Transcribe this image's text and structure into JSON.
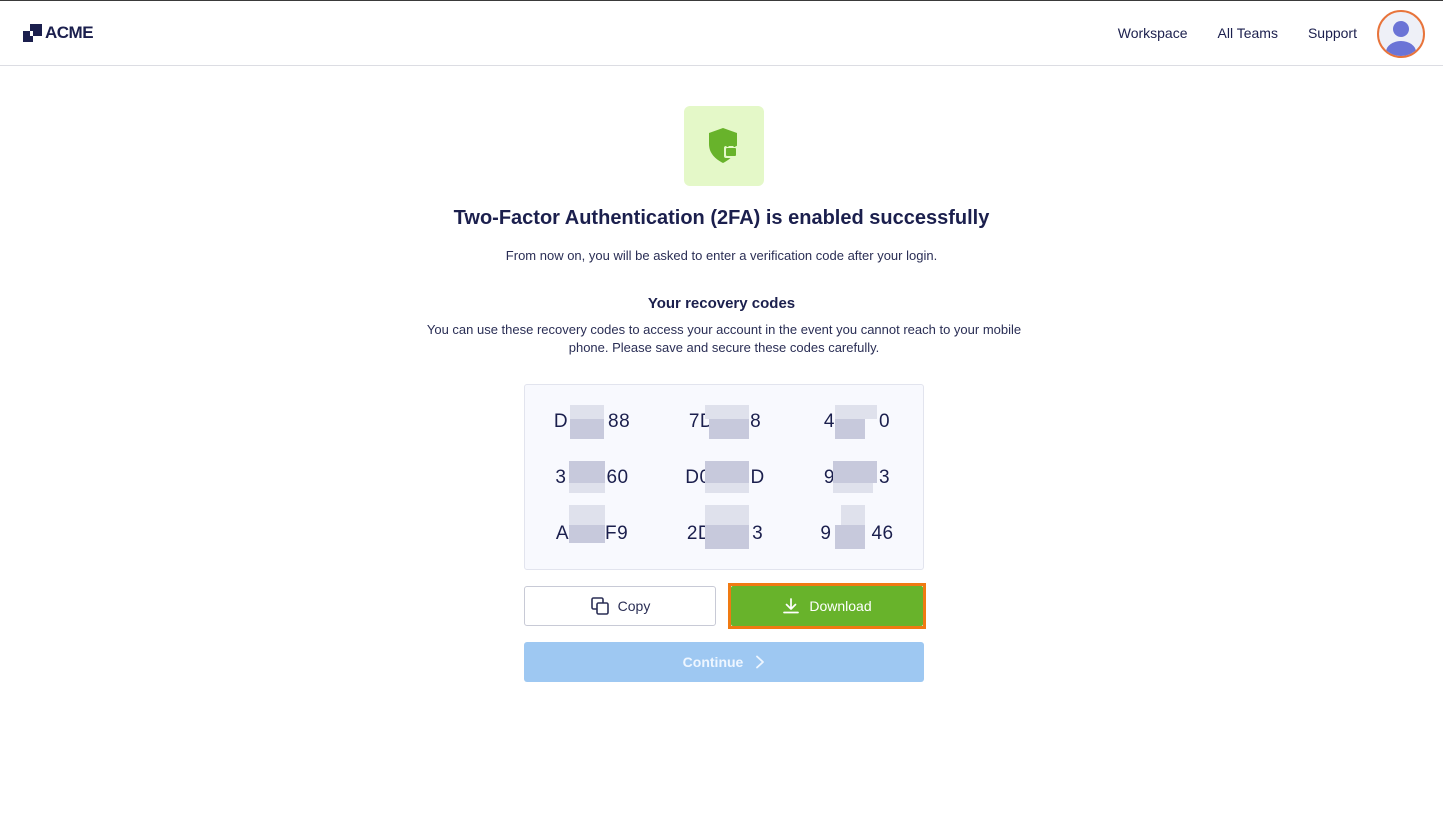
{
  "header": {
    "logo_text": "ACME",
    "nav": [
      {
        "label": "Workspace"
      },
      {
        "label": "All Teams"
      },
      {
        "label": "Support"
      }
    ]
  },
  "main": {
    "title": "Two-Factor Authentication (2FA) is enabled successfully",
    "subtitle": "From now on, you will be asked to enter a verification code after your login.",
    "codes_heading": "Your recovery codes",
    "codes_description": "You can use these recovery codes to access your account in the event you cannot reach to your mobile phone. Please save and secure these codes carefully.",
    "codes": [
      {
        "prefix": "D",
        "suffix": "88"
      },
      {
        "prefix": "7D",
        "suffix": "8"
      },
      {
        "prefix": "4",
        "suffix": "0"
      },
      {
        "prefix": "3",
        "suffix": "60"
      },
      {
        "prefix": "D0",
        "suffix": "D"
      },
      {
        "prefix": "9",
        "suffix": "3"
      },
      {
        "prefix": "A",
        "suffix": "F9"
      },
      {
        "prefix": "2D",
        "suffix": "3"
      },
      {
        "prefix": "9",
        "suffix": "46"
      }
    ],
    "copy_label": "Copy",
    "download_label": "Download",
    "continue_label": "Continue"
  },
  "colors": {
    "primary_text": "#1b1f4d",
    "success_green": "#68b32b",
    "shield_bg": "#e4f8c8",
    "continue_disabled": "#9ec8f2",
    "highlight_outline": "#f07a12"
  },
  "icons": [
    "acme-logo-icon",
    "user-avatar-icon",
    "shield-lock-icon",
    "copy-icon",
    "download-icon",
    "chevron-right-icon"
  ]
}
